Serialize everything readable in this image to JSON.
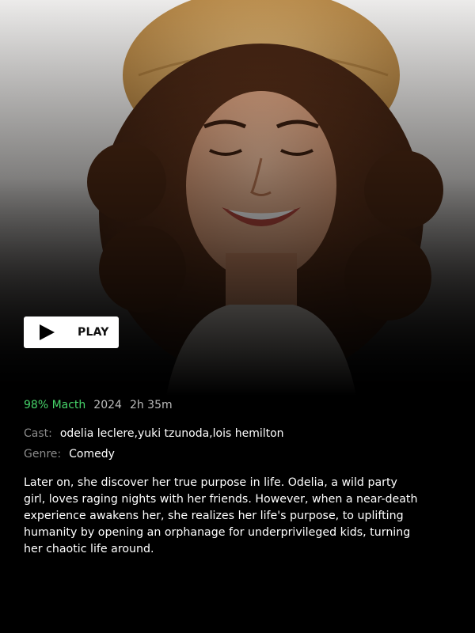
{
  "hero": {
    "image_subject": "smiling woman with curly hair wearing a straw hat"
  },
  "play_button": {
    "label": "PLAY",
    "icon": "play-icon"
  },
  "meta": {
    "match": "98% Macth",
    "year": "2024",
    "duration": "2h 35m"
  },
  "details": {
    "cast_label": "Cast:",
    "cast_value": "odelia leclere,yuki tzunoda,lois hemilton",
    "genre_label": "Genre:",
    "genre_value": "Comedy"
  },
  "description": "Later on, she discover her true purpose in life. Odelia, a wild party girl, loves raging nights with her friends. However, when a near-death experience awakens her, she realizes her life's purpose, to uplifting humanity by opening an orphanage for underprivileged kids, turning her chaotic life around.",
  "colors": {
    "background": "#000000",
    "match_green": "#46d369",
    "meta_gray": "#bcbcbc",
    "label_gray": "#8c8c8c"
  }
}
